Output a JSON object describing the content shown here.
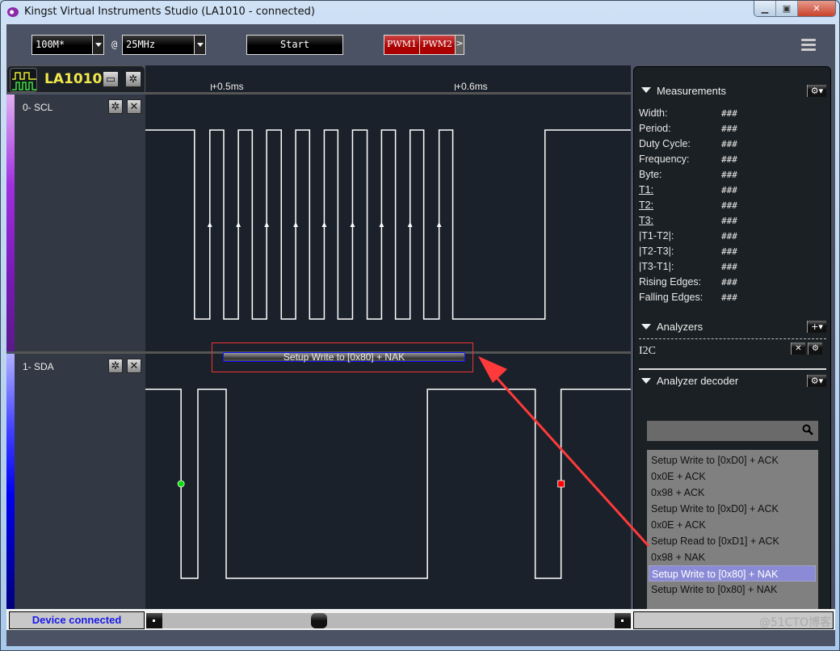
{
  "window": {
    "title": "Kingst Virtual Instruments Studio (LA1010 - connected)",
    "controls": [
      "minimize",
      "maximize",
      "close"
    ]
  },
  "toolbar": {
    "sample_depth": "100M*",
    "at_label": "@",
    "sample_rate": "25MHz",
    "start_label": "Start",
    "pwm1_label": "PWM1",
    "pwm2_label": "PWM2",
    "pwm_more_label": ">"
  },
  "device": {
    "name": "LA1010"
  },
  "time_ruler": {
    "ticks": [
      {
        "label": "+0.5ms",
        "time_ms": 0.5
      },
      {
        "label": "+0.6ms",
        "time_ms": 0.6
      }
    ]
  },
  "channels": [
    {
      "name": "0-  SCL",
      "stripe_colors": [
        "#e0b0f0",
        "#8a18d8",
        "#5a1a8a"
      ],
      "start_level": 1,
      "transitions_ms": [
        0.4933,
        0.4996,
        0.5053,
        0.5113,
        0.517,
        0.5229,
        0.5289,
        0.5348,
        0.5405,
        0.5465,
        0.5521,
        0.5581,
        0.5641,
        0.57,
        0.5757,
        0.5817,
        0.5873,
        0.5936,
        0.5992,
        0.637
      ],
      "rising_edge_markers_ms": [
        0.4996,
        0.5113,
        0.5229,
        0.5348,
        0.5465,
        0.5581,
        0.57,
        0.5817,
        0.5936
      ]
    },
    {
      "name": "1-  SDA",
      "stripe_colors": [
        "#b0b0ff",
        "#1010ff",
        "#00007a"
      ],
      "start_level": 1,
      "transitions_ms": [
        0.4878,
        0.4947,
        0.5063,
        0.5888,
        0.633,
        0.6436
      ],
      "start_marker_ms": 0.4878,
      "stop_marker_ms": 0.6436
    }
  ],
  "decoded_frame": {
    "text": "Setup Write to [0x80] + NAK"
  },
  "measurements": {
    "title": "Measurements",
    "rows": [
      {
        "label": "Width:",
        "value": "###",
        "underline": false
      },
      {
        "label": "Period:",
        "value": "###",
        "underline": false
      },
      {
        "label": "Duty Cycle:",
        "value": "###",
        "underline": false
      },
      {
        "label": "Frequency:",
        "value": "###",
        "underline": false
      },
      {
        "label": "Byte:",
        "value": "###",
        "underline": false
      },
      {
        "label": "T1:",
        "value": "###",
        "underline": true
      },
      {
        "label": "T2:",
        "value": "###",
        "underline": true
      },
      {
        "label": "T3:",
        "value": "###",
        "underline": true
      },
      {
        "label": "|T1-T2|:",
        "value": "###",
        "underline": false
      },
      {
        "label": "|T2-T3|:",
        "value": "###",
        "underline": false
      },
      {
        "label": "|T3-T1|:",
        "value": "###",
        "underline": false
      },
      {
        "label": "Rising Edges:",
        "value": "###",
        "underline": false
      },
      {
        "label": "Falling Edges:",
        "value": "###",
        "underline": false
      }
    ]
  },
  "analyzers": {
    "title": "Analyzers",
    "items": [
      {
        "label": "I2C"
      }
    ]
  },
  "analyzer_decoder": {
    "title": "Analyzer decoder",
    "search_value": "",
    "items": [
      {
        "text": "Setup Write to [0xD0] + ACK",
        "selected": false
      },
      {
        "text": "0x0E + ACK",
        "selected": false
      },
      {
        "text": "0x98 + ACK",
        "selected": false
      },
      {
        "text": "Setup Write to [0xD0] + ACK",
        "selected": false
      },
      {
        "text": "0x0E + ACK",
        "selected": false
      },
      {
        "text": "Setup Read to [0xD1] + ACK",
        "selected": false
      },
      {
        "text": "0x98 + NAK",
        "selected": false
      },
      {
        "text": "Setup Write to [0x80] + NAK",
        "selected": true
      },
      {
        "text": "Setup Write to [0x80] + NAK",
        "selected": false
      }
    ]
  },
  "status": {
    "text": "Device connected",
    "scroll_position": 0.34
  },
  "watermark": "@51CTO博客",
  "annotation": {
    "color": "#ff3a3a"
  }
}
